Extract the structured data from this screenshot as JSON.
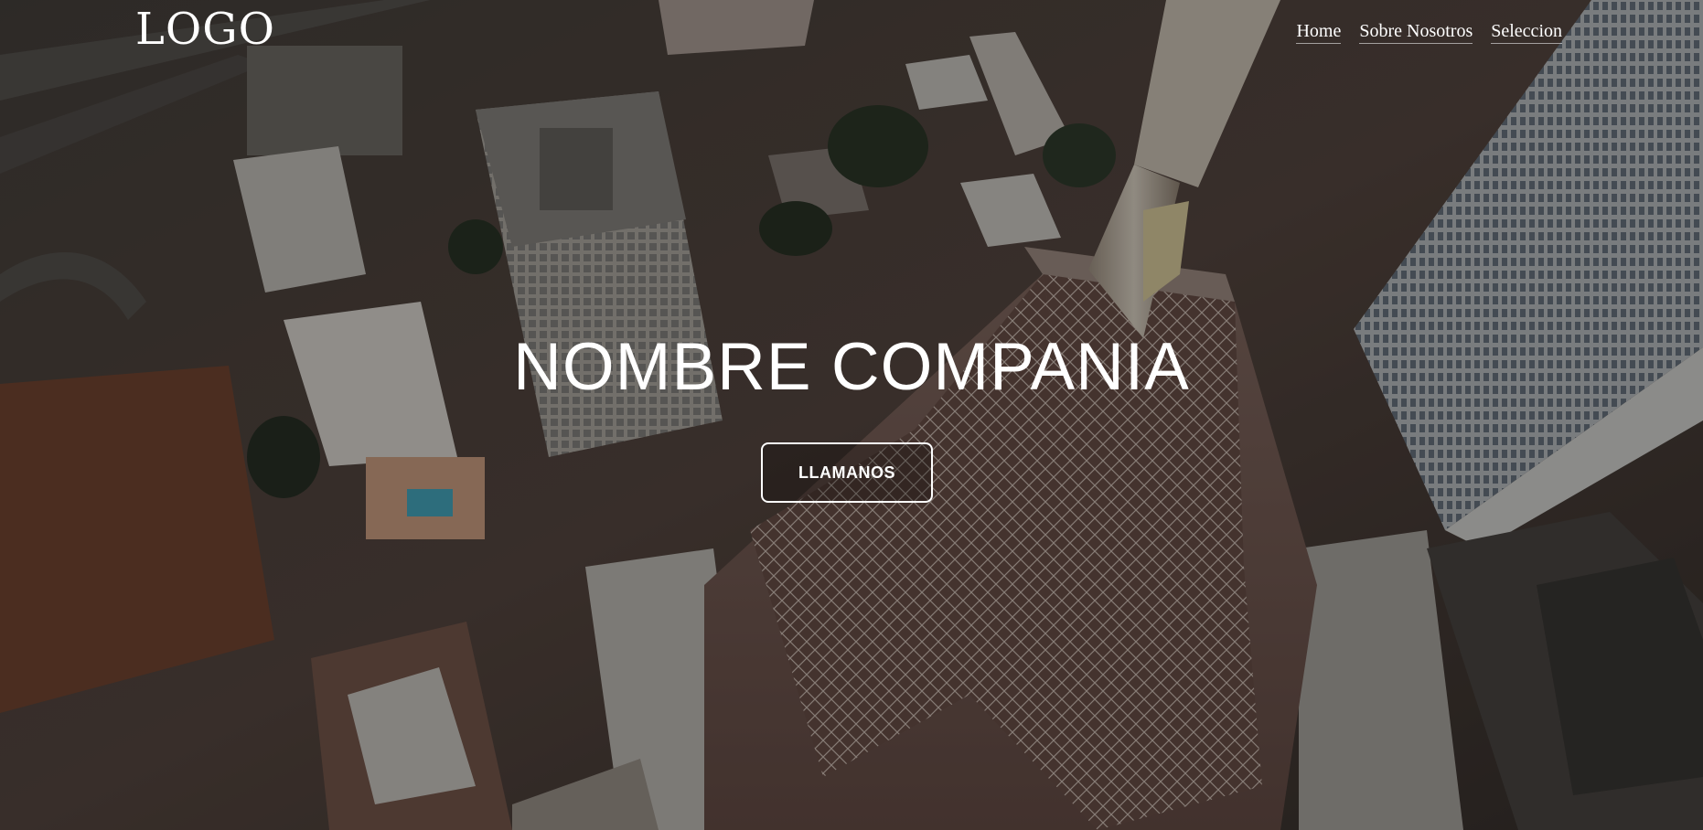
{
  "header": {
    "logo_text": "LOGO",
    "nav": [
      {
        "label": "Home"
      },
      {
        "label": "Sobre Nosotros"
      },
      {
        "label": "Seleccion"
      }
    ]
  },
  "hero": {
    "title": "NOMBRE COMPANIA",
    "cta_label": "LLAMANOS",
    "background": "aerial-city-photo"
  },
  "colors": {
    "text": "#ffffff",
    "overlay": "#000000"
  }
}
